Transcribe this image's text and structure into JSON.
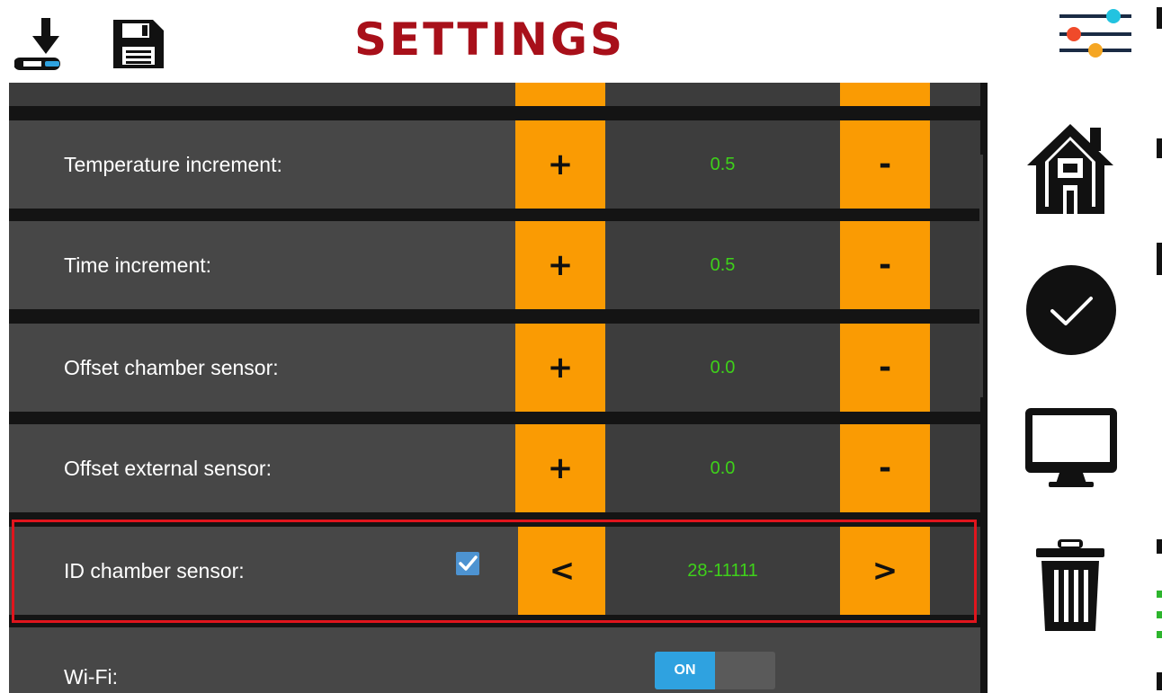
{
  "header": {
    "title": "SETTINGS",
    "icons": [
      "download-icon",
      "save-icon",
      "sliders-icon"
    ]
  },
  "rows": [
    {
      "label": "Temperature increment:",
      "plus": "+",
      "value": "0.5",
      "minus": "-"
    },
    {
      "label": "Time increment:",
      "plus": "+",
      "value": "0.5",
      "minus": "-"
    },
    {
      "label": "Offset chamber sensor:",
      "plus": "+",
      "value": "0.0",
      "minus": "-"
    },
    {
      "label": "Offset external sensor:",
      "plus": "+",
      "value": "0.0",
      "minus": "-"
    },
    {
      "label": "ID chamber sensor:",
      "plus": "<",
      "value": "28-11111",
      "minus": ">",
      "checked": true,
      "highlighted": true
    }
  ],
  "wifi": {
    "label": "Wi-Fi:",
    "toggle": "ON",
    "state": true
  },
  "sidebar": {
    "icons": [
      "home-icon",
      "check-icon",
      "monitor-icon",
      "trash-icon"
    ]
  },
  "colors": {
    "accent": "#fa9b03",
    "value_text": "#3ed11a",
    "title": "#a8101a",
    "highlight": "#e0151d",
    "toggle_on": "#2fa2e0"
  }
}
